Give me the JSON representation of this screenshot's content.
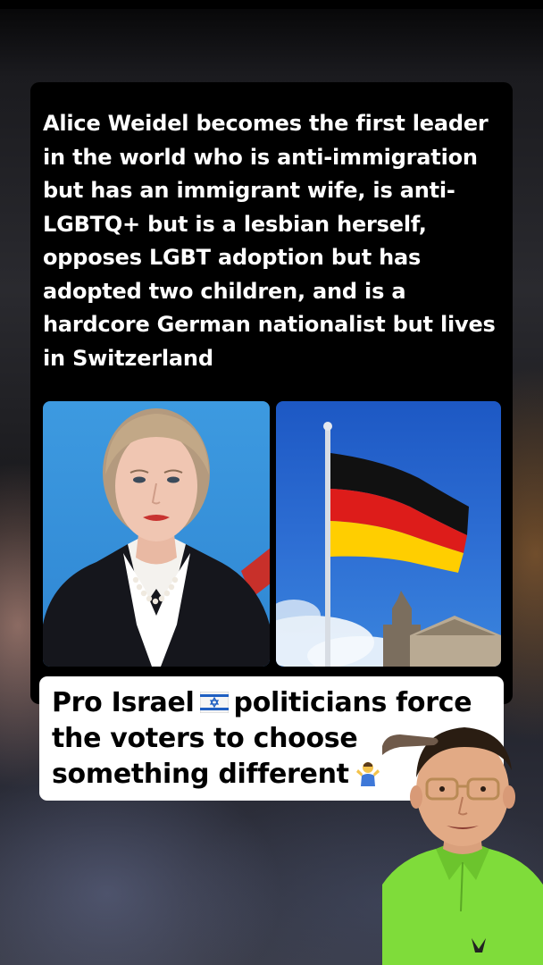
{
  "post": {
    "text_lines": [
      "Alice Weidel becomes the first leader",
      "in the world who is anti-immigration",
      "but has an immigrant wife, is anti-",
      "LGBTQ+ but is a lesbian herself,",
      "opposes LGBT adoption but has",
      "adopted two children, and is a",
      "hardcore German nationalist but lives",
      "in Switzerland"
    ]
  },
  "images": {
    "left": "portrait-photo",
    "right": "german-flag-photo"
  },
  "caption": {
    "line1_a": "Pro Israel",
    "line1_b": "politicians force",
    "line2": "the voters to choose",
    "line3": "something different",
    "flag_icon": "israel-flag-icon",
    "shrug_icon": "person-shrugging-icon"
  },
  "colors": {
    "card_bg": "#000000",
    "text": "#ffffff",
    "caption_bg": "#ffffff",
    "caption_text": "#000000",
    "flag_black": "#111111",
    "flag_red": "#dd1c1a",
    "flag_gold": "#ffce00",
    "shirt": "#7fdc3a"
  }
}
